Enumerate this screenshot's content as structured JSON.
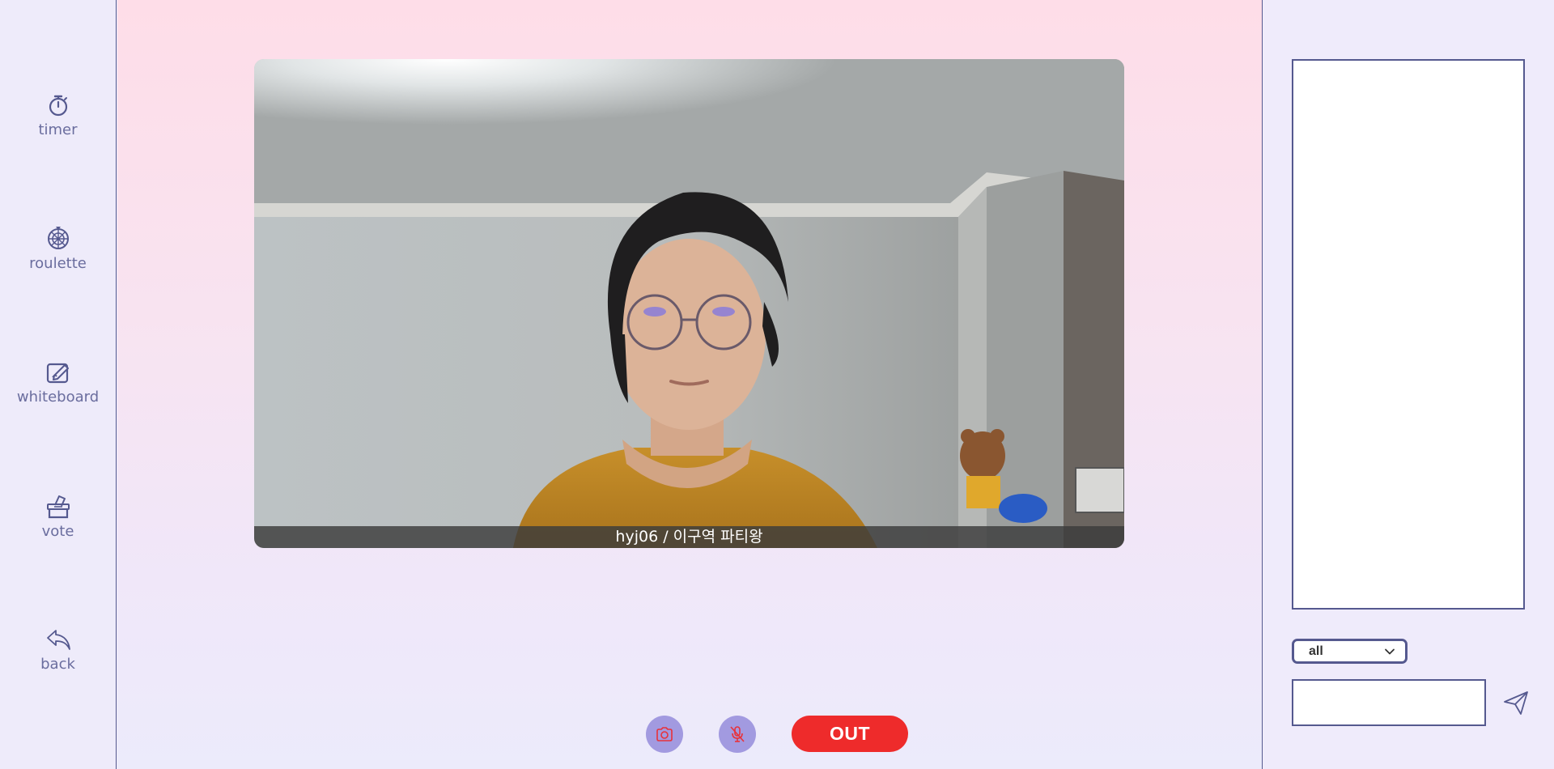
{
  "sidebar": {
    "items": [
      {
        "label": "timer",
        "icon": "stopwatch-icon"
      },
      {
        "label": "roulette",
        "icon": "roulette-wheel-icon"
      },
      {
        "label": "whiteboard",
        "icon": "edit-board-icon"
      },
      {
        "label": "vote",
        "icon": "ballot-box-icon"
      },
      {
        "label": "back",
        "icon": "reply-arrow-icon"
      }
    ]
  },
  "video": {
    "caption": "hyj06 / 이구역 파티왕"
  },
  "controls": {
    "camera_icon": "camera-icon",
    "mic_icon": "microphone-icon",
    "out_label": "OUT"
  },
  "chat": {
    "target_selected": "all",
    "input_value": "",
    "send_icon": "send-paper-plane-icon"
  },
  "colors": {
    "accent": "#55598f",
    "control_button": "#a29ae0",
    "out_button": "#ee2b2b",
    "sidebar_bg": "#eeebfa"
  }
}
